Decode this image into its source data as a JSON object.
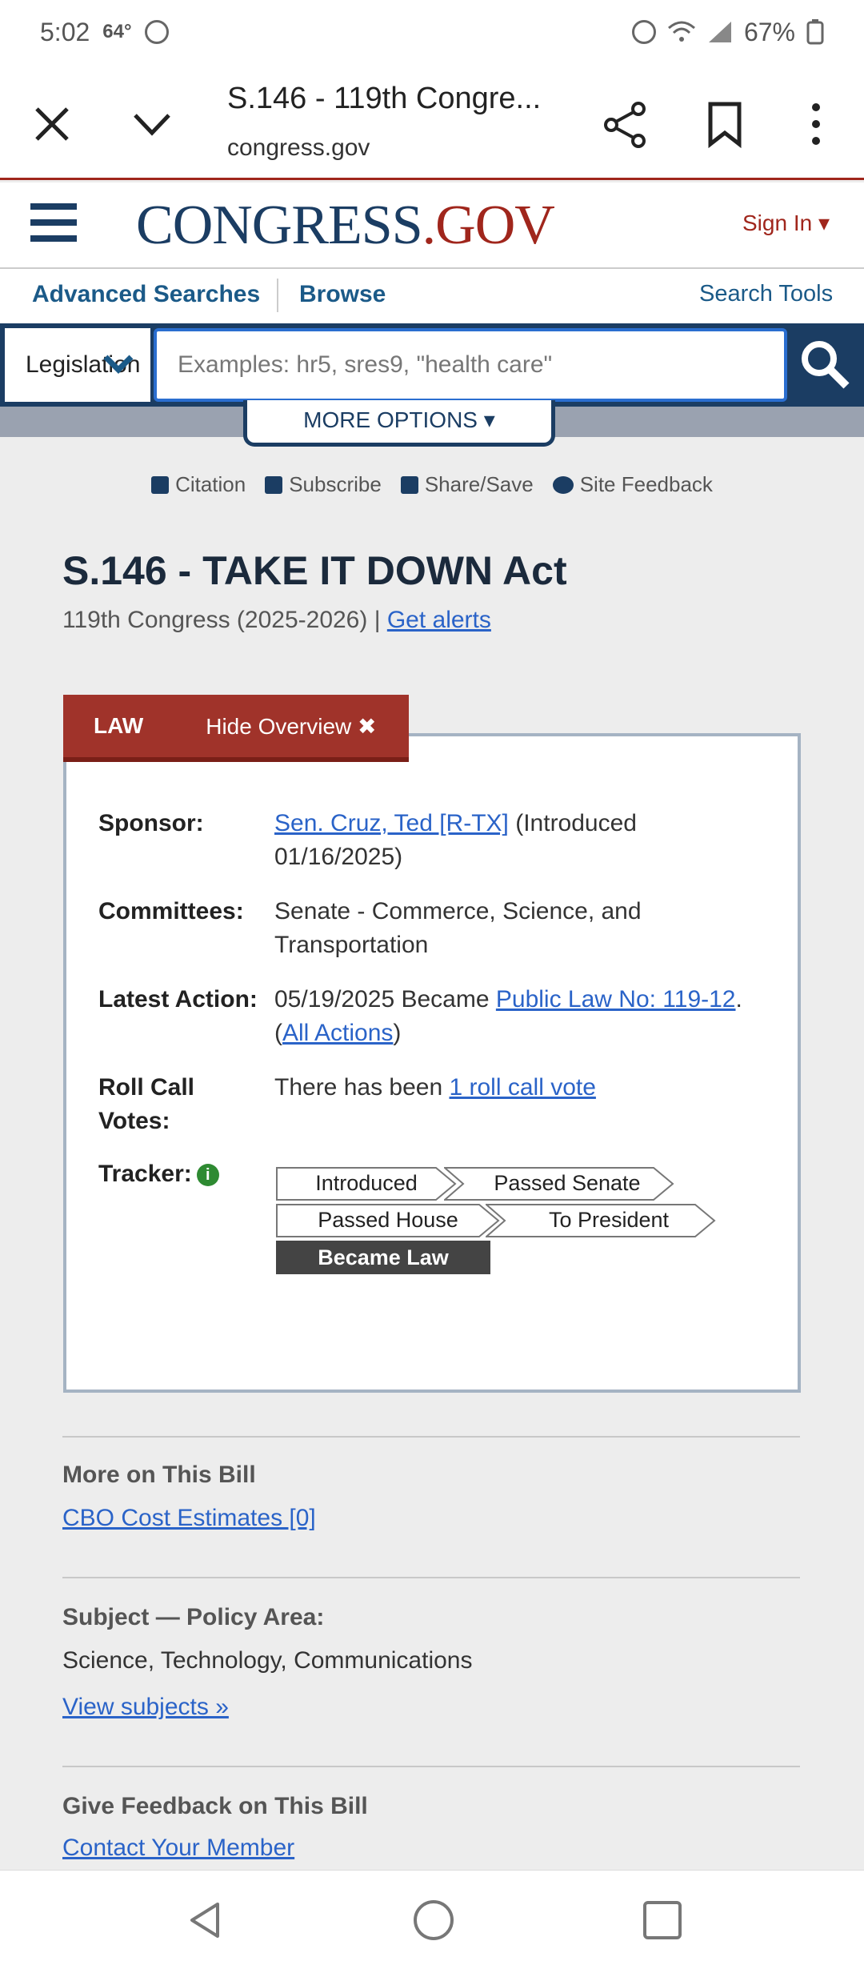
{
  "status": {
    "time": "5:02",
    "temp": "64°",
    "battery": "67%"
  },
  "browser": {
    "title": "S.146 - 119th Congre...",
    "domain": "congress.gov"
  },
  "header": {
    "logo_main": "CONGRESS",
    "logo_dot": ".",
    "logo_gov": "GOV",
    "sign_in": "Sign In ▾"
  },
  "nav": {
    "advanced": "Advanced Searches",
    "browse": "Browse",
    "tools": "Search Tools"
  },
  "search": {
    "scope": "Legislation",
    "placeholder": "Examples: hr5, sres9, \"health care\"",
    "more_options": "MORE OPTIONS ▾"
  },
  "actions": {
    "citation": "Citation",
    "subscribe": "Subscribe",
    "share": "Share/Save",
    "feedback": "Site Feedback"
  },
  "bill": {
    "title": "S.146 - TAKE IT DOWN Act",
    "congress": "119th Congress (2025-2026) | ",
    "get_alerts": "Get alerts"
  },
  "overview": {
    "status_tab": "LAW",
    "hide_label": "Hide Overview ✖",
    "sponsor_label": "Sponsor:",
    "sponsor_name": "Sen. Cruz, Ted [R-TX]",
    "sponsor_intro": " (Introduced 01/16/2025)",
    "committees_label": "Committees:",
    "committees": "Senate - Commerce, Science, and Transportation",
    "latest_label": "Latest Action:",
    "latest_text": "05/19/2025 Became ",
    "latest_link": "Public Law No: 119-12",
    "latest_sep": ".  (",
    "all_actions": "All Actions",
    "latest_close": ")",
    "roll_label": "Roll Call Votes:",
    "roll_text": "There has been ",
    "roll_link": "1 roll call vote",
    "tracker_label": "Tracker:",
    "tracker_info": "i",
    "tracker_steps": [
      "Introduced",
      "Passed Senate",
      "Passed House",
      "To President",
      "Became Law"
    ]
  },
  "more": {
    "heading": "More on This Bill",
    "cbo": "CBO Cost Estimates [0]"
  },
  "subject": {
    "heading": "Subject — Policy Area:",
    "value": "Science, Technology, Communications",
    "view": "View subjects »"
  },
  "feedback": {
    "heading": "Give Feedback on This Bill",
    "contact": "Contact Your Member"
  }
}
